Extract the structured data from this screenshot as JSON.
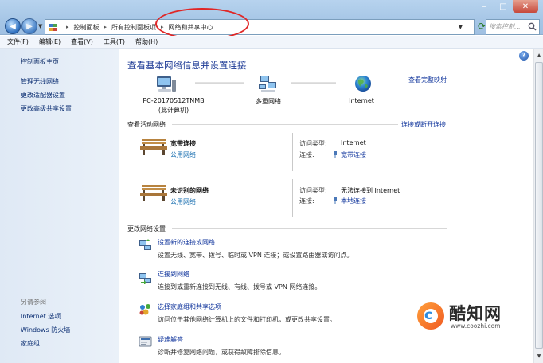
{
  "window": {
    "controls": {
      "minimize": "–",
      "maximize": "□",
      "close": "✕"
    }
  },
  "address_bar": {
    "crumbs": [
      "控制面板",
      "所有控制面板项",
      "网络和共享中心"
    ],
    "search_placeholder": "搜索控制..."
  },
  "menu": [
    "文件(F)",
    "编辑(E)",
    "查看(V)",
    "工具(T)",
    "帮助(H)"
  ],
  "sidebar": {
    "home": "控制面板主页",
    "links": [
      "管理无线网络",
      "更改适配器设置",
      "更改高级共享设置"
    ],
    "see_also_heading": "另请参阅",
    "see_also": [
      "Internet 选项",
      "Windows 防火墙",
      "家庭组"
    ]
  },
  "main": {
    "title": "查看基本网络信息并设置连接",
    "full_map_link": "查看完整映射",
    "nodes": {
      "computer_name": "PC-20170512TNMB",
      "computer_sub": "(此计算机)",
      "multi": "多重网络",
      "internet": "Internet"
    },
    "active_heading": "查看活动网络",
    "connect_link": "连接或断开连接",
    "networks": [
      {
        "name": "宽带连接",
        "type": "公用网络",
        "access_label": "访问类型:",
        "access_value": "Internet",
        "conn_label": "连接:",
        "conn_value": "宽带连接"
      },
      {
        "name": "未识别的网络",
        "type": "公用网络",
        "access_label": "访问类型:",
        "access_value": "无法连接到 Internet",
        "conn_label": "连接:",
        "conn_value": "本地连接"
      }
    ],
    "settings_heading": "更改网络设置",
    "tasks": [
      {
        "title": "设置新的连接或网络",
        "desc": "设置无线、宽带、拨号、临时或 VPN 连接；或设置路由器或访问点。"
      },
      {
        "title": "连接到网络",
        "desc": "连接到或重新连接到无线、有线、拨号或 VPN 网络连接。"
      },
      {
        "title": "选择家庭组和共享选项",
        "desc": "访问位于其他网络计算机上的文件和打印机，或更改共享设置。"
      },
      {
        "title": "疑难解答",
        "desc": "诊断并修复网络问题，或获得故障排除信息。"
      }
    ]
  },
  "watermark": {
    "title": "酷知网",
    "url": "www.coozhi.com"
  }
}
